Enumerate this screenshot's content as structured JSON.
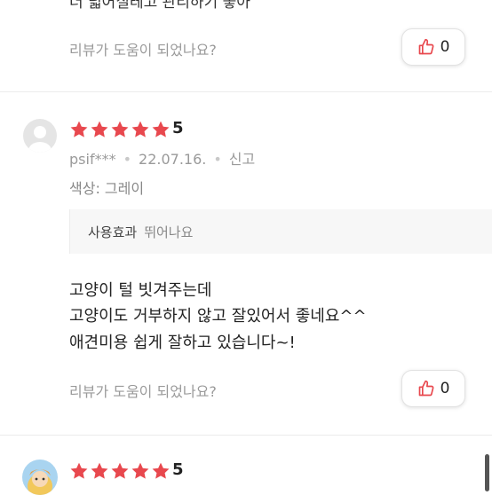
{
  "top_review": {
    "partial_text": "더 넓어질테고 관리하기 좋아",
    "helpful_question": "리뷰가 도움이 되었나요?",
    "helpful_count": "0"
  },
  "review1": {
    "rating": 5,
    "rating_label": "5",
    "user": "psif***",
    "date": "22.07.16.",
    "report_label": "신고",
    "option_label": "색상: 그레이",
    "effect_key": "사용효과",
    "effect_value": "뛰어나요",
    "body_lines": [
      "고양이 털 빗겨주는데",
      "고양이도 거부하지 않고 잘있어서 좋네요^^",
      "애견미용 쉽게 잘하고 있습니다~!"
    ],
    "helpful_question": "리뷰가 도움이 되었나요?",
    "helpful_count": "0"
  },
  "review2": {
    "rating": 5,
    "rating_label": "5"
  },
  "colors": {
    "star": "#e8484e",
    "thumb": "#e8484e"
  }
}
